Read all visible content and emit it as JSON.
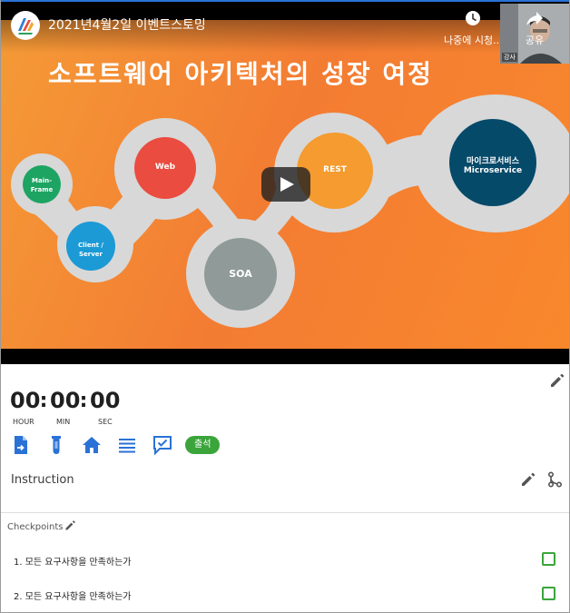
{
  "video": {
    "title": "2021년4월2일 이벤트스토밍",
    "watch_later_label": "나중에 시청...",
    "share_label": "공유",
    "webcam_label": "강사",
    "slide": {
      "title": "소프트웨어 아키텍처의 성장 여정",
      "nodes": {
        "mainframe": "Main-Frame",
        "client_server": "Client / Server",
        "web": "Web",
        "soa": "SOA",
        "rest": "REST",
        "microservice_ko": "마이크로서비스",
        "microservice_en": "Microservice"
      }
    },
    "colors": {
      "slide_orange": "#f37c33",
      "mainframe": "#1da463",
      "client_server": "#1b9ad6",
      "web": "#ea4c3f",
      "soa": "#8f9a99",
      "rest": "#f59b2f",
      "microservice": "#064a6a"
    }
  },
  "timer": {
    "hours": "00",
    "minutes": "00",
    "seconds": "00",
    "hour_label": "HOUR",
    "min_label": "MIN",
    "sec_label": "SEC"
  },
  "toolbar": {
    "attendance_label": "출석",
    "icons": [
      "document-arrow-icon",
      "test-tube-icon",
      "home-icon",
      "list-icon",
      "chat-check-icon"
    ],
    "accent_color": "#2a72d6"
  },
  "instruction": {
    "label": "Instruction"
  },
  "checkpoints": {
    "title": "Checkpoints",
    "items": [
      {
        "label": "1. 모든 요구사항을 만족하는가",
        "checked": false
      },
      {
        "label": "2. 모든 요구사항을 만족하는가",
        "checked": false
      }
    ],
    "check_color": "#3ba53b"
  }
}
